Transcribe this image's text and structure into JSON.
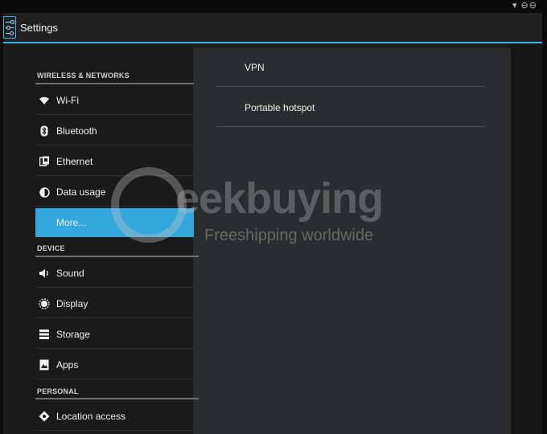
{
  "status_bar": {
    "icons_text": "▾ ⊖⊖"
  },
  "action_bar": {
    "title": "Settings",
    "icon": "settings-sliders-icon"
  },
  "categories": {
    "wireless": "WIRELESS & NETWORKS",
    "device": "DEVICE",
    "personal": "PERSONAL"
  },
  "items": [
    {
      "label": "Wi-Fi",
      "icon": "wifi-icon"
    },
    {
      "label": "Bluetooth",
      "icon": "bluetooth-icon"
    },
    {
      "label": "Ethernet",
      "icon": "ethernet-icon"
    },
    {
      "label": "Data usage",
      "icon": "data-usage-icon"
    },
    {
      "label": "More...",
      "icon": "none",
      "selected": true
    },
    {
      "label": "Sound",
      "icon": "sound-icon"
    },
    {
      "label": "Display",
      "icon": "display-icon"
    },
    {
      "label": "Storage",
      "icon": "storage-icon"
    },
    {
      "label": "Apps",
      "icon": "apps-icon"
    },
    {
      "label": "Location access",
      "icon": "location-icon"
    }
  ],
  "detail_items": [
    {
      "label": "VPN"
    },
    {
      "label": "Portable hotspot"
    }
  ],
  "watermark": {
    "brand": "eekbuying",
    "tagline": "Freeshipping worldwide"
  },
  "colors": {
    "accent": "#34b5e5",
    "selected_bg": "#34a7dc"
  }
}
